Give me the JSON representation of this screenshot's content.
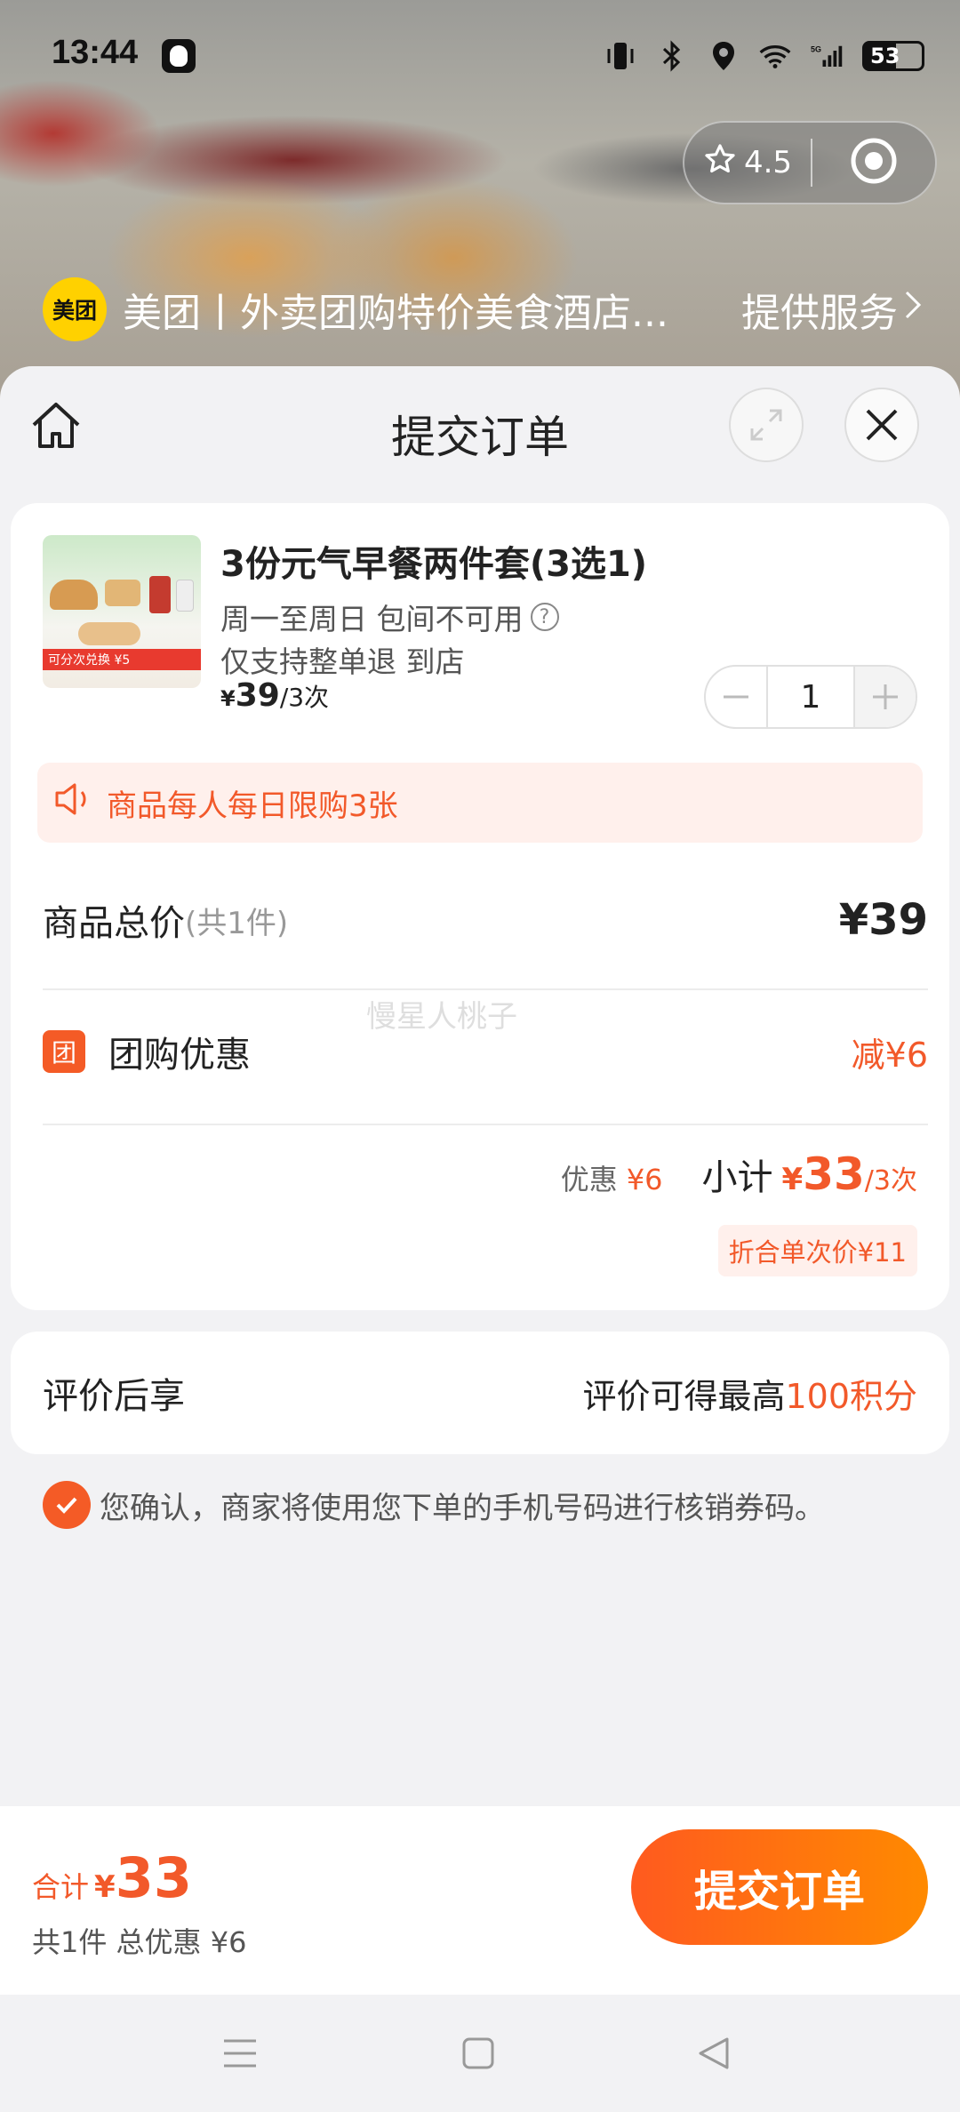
{
  "status": {
    "time": "13:44",
    "battery": "53"
  },
  "capsule": {
    "rating": "4.5"
  },
  "mini_program": {
    "logo": "美团",
    "title": "美团丨外卖团购特价美食酒店...",
    "service": "提供服务"
  },
  "sheet": {
    "title": "提交订单"
  },
  "product": {
    "name": "3份元气早餐两件套(3选1)",
    "line1": "周一至周日 包间不可用",
    "line2": "仅支持整单退 到店",
    "price_currency": "¥",
    "price": "39",
    "price_unit": "/3次",
    "image_tag": "可分次兑换 ¥5",
    "quantity": "1"
  },
  "limit_notice": "商品每人每日限购3张",
  "totals": {
    "goods_label": "商品总价",
    "goods_count": "(共1件)",
    "goods_value": "¥39",
    "discount_icon": "团",
    "discount_label": "团购优惠",
    "discount_value": "减¥6",
    "watermark": "慢星人桃子",
    "yh_label": "优惠",
    "yh_value": "¥6",
    "subtotal_label": "小计",
    "subtotal_currency": "¥",
    "subtotal_value": "33",
    "subtotal_unit": "/3次",
    "per_use": "折合单次价¥11"
  },
  "review": {
    "label": "评价后享",
    "text": "评价可得最高",
    "points": "100积分"
  },
  "confirm_text": "您确认，商家将使用您下单的手机号码进行核销券码。",
  "footer": {
    "total_label": "合计",
    "total_currency": "¥",
    "total_value": "33",
    "sub": "共1件 总优惠 ¥6",
    "submit": "提交订单"
  },
  "colors": {
    "accent": "#f2592a",
    "meituan_yellow": "#ffd100"
  }
}
